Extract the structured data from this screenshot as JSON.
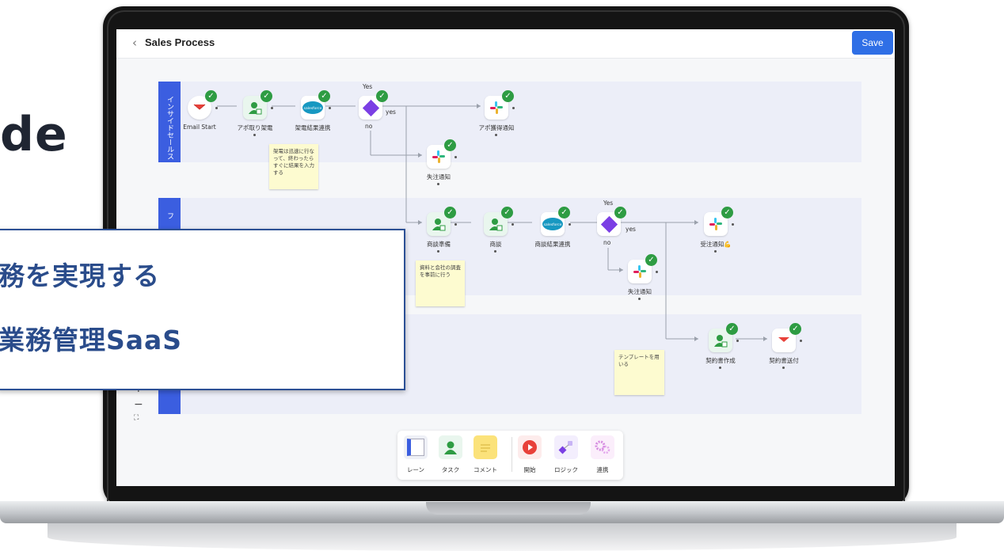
{
  "background_word": "de",
  "header": {
    "back_icon": "‹",
    "title": "Sales Process",
    "save_label": "Save"
  },
  "lanes": [
    {
      "label": "インサイドセールス"
    },
    {
      "label": "フ"
    }
  ],
  "nodes": {
    "email_start": "Email Start",
    "apo_call": "アポ取り架電",
    "call_result_sync": "架電結果連携",
    "apo_notify": "アポ獲得通知",
    "lost_notify_1": "失注通知",
    "meeting_prep": "商談準備",
    "meeting": "商談",
    "meeting_result_sync": "商談結果連携",
    "won_notify": "受注通知💪",
    "lost_notify_2": "失注通知",
    "contract_create": "契約書作成",
    "contract_send": "契約書送付",
    "salesforce_text": "salesforce"
  },
  "branches": {
    "yes_top": "Yes",
    "yes_side": "yes",
    "no": "no"
  },
  "stickies": {
    "note1": "架電は迅速に行なって、終わったらすぐに結果を入力する",
    "note2": "資料と会社の調査を事前に行う",
    "note3": "テンプレートを用いる"
  },
  "zoom": {
    "plus": "+",
    "minus": "−",
    "fit": "⛶"
  },
  "palette": [
    {
      "label": "レーン",
      "icon": "lane-icon"
    },
    {
      "label": "タスク",
      "icon": "task-person-icon"
    },
    {
      "label": "コメント",
      "icon": "comment-note-icon"
    },
    {
      "label": "開始",
      "icon": "start-play-icon"
    },
    {
      "label": "ロジック",
      "icon": "logic-icon"
    },
    {
      "label": "連携",
      "icon": "integration-gear-icon"
    }
  ],
  "callout": {
    "line1": "務を実現する",
    "line2": "業務管理SaaS"
  },
  "colors": {
    "accent": "#3b5ee0",
    "save": "#2f6fe6",
    "check": "#2e9c43",
    "diamond": "#7b3fe4",
    "callout_text": "#2a4c8b"
  }
}
